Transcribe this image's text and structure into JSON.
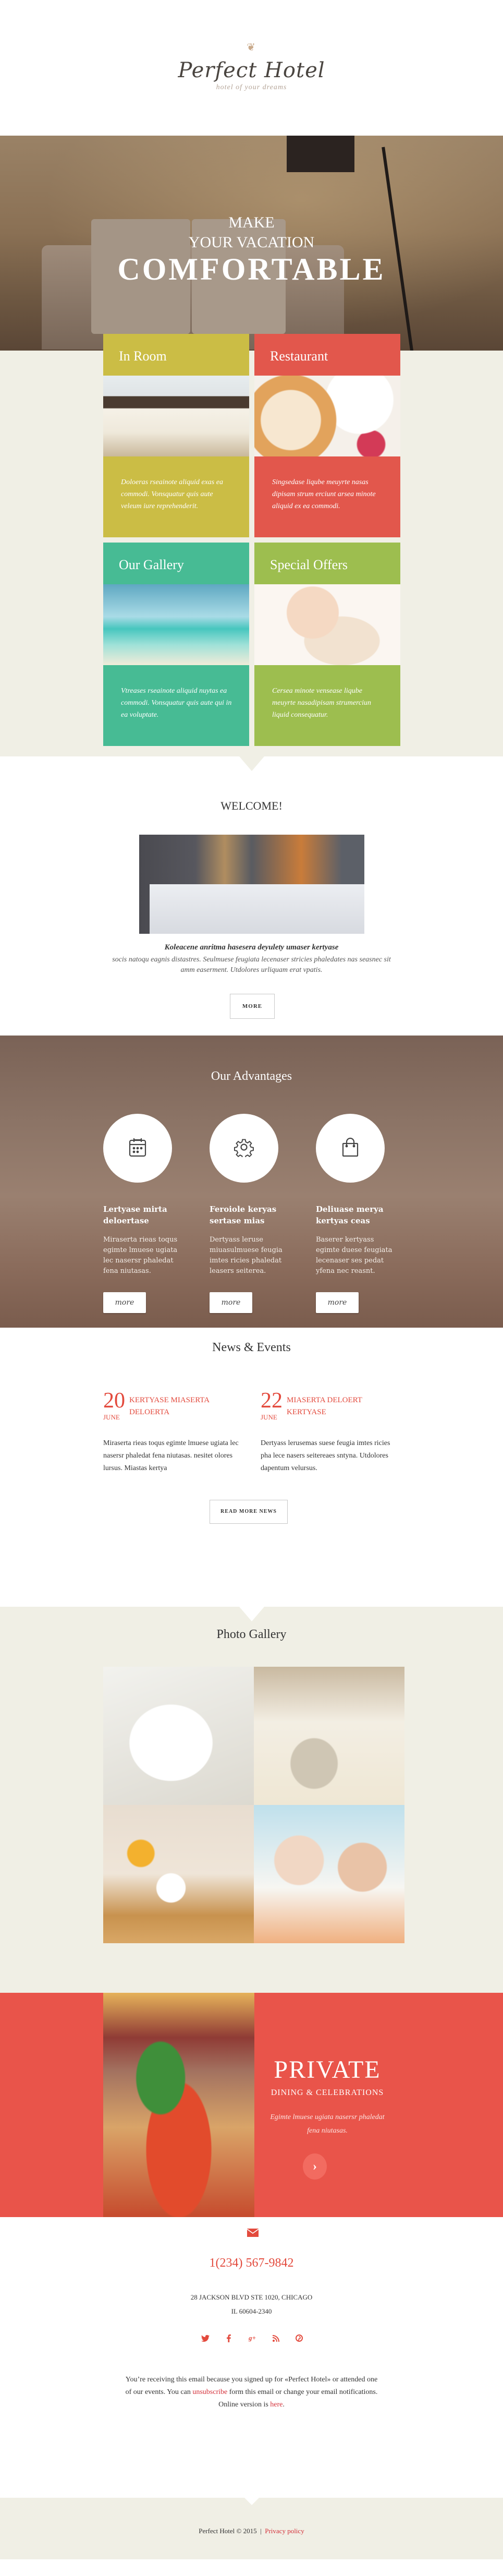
{
  "header": {
    "logo_text": "Perfect Hotel",
    "tagline": "hotel of your dreams",
    "ornament": "❦"
  },
  "hero": {
    "line1": "MAKE",
    "line2": "YOUR VACATION",
    "line3": "COMFORTABLE"
  },
  "features": [
    {
      "title": "In Room",
      "text": "Doloeras rseainote aliquid exas ea commodi. Vonsquatur quis aute veleum iure reprehenderit.",
      "color": "#cbbd45"
    },
    {
      "title": "Restaurant",
      "text": "Singsedase liqube meuyrte nasas dipisam strum erciunt arsea minote aliquid ex ea commodi.",
      "color": "#e2574c"
    },
    {
      "title": "Our Gallery",
      "text": "Vtreases rseainote aliquid nuytas ea commodi. Vonsquatur quis aute qui in ea voluptate.",
      "color": "#47bb94"
    },
    {
      "title": "Special Offers",
      "text": "Cersea minote vensease liqube meuyrte nasadipisam strumerciun liquid consequatur.",
      "color": "#9dbe4f"
    }
  ],
  "welcome": {
    "title": "WELCOME!",
    "bold_line": "Koleacene anritma hasesera deyulety umaser kertyase",
    "text": "socis natoqu eagnis distastres. Seulmuese feugiata lecenaser stricies phaledates nas seasnec sit amm easerment. Utdolores urliquam erat vpatis.",
    "button": "MORE"
  },
  "advantages": {
    "title": "Our Advantages",
    "items": [
      {
        "icon": "calendar-icon",
        "heading": "Lertyase mirta deloertase",
        "text": "Miraserta rieas toqus egimte lmuese ugiata lec nasersr phaledat fena niutasas.",
        "button": "more"
      },
      {
        "icon": "gear-icon",
        "heading": "Feroiole keryas sertase mias",
        "text": "Dertyass leruse miuasulmuese feugia imtes ricies phaledat leasers seiterea.",
        "button": "more"
      },
      {
        "icon": "shopping-bag-icon",
        "heading": "Deliuase merya kertyas ceas",
        "text": "Baserer kertyass egimte duese feugiata lecenaser ses pedat yfena nec reasnt.",
        "button": "more"
      }
    ]
  },
  "news": {
    "title": "News & Events",
    "items": [
      {
        "day": "20",
        "month": "JUNE",
        "headline": "KERTYASE MIASERTA DELOERTA",
        "body": "Miraserta rieas toqus egimte lmuese ugiata lec nasersr phaledat fena niutasas. nesitet olores lursus. Miastas kertya"
      },
      {
        "day": "22",
        "month": "JUNE",
        "headline": "MIASERTA DELOERT KERTYASE",
        "body": "Dertyass lerusemas suese feugia imtes ricies pha lece nasers seitereaes sntyna. Utdolores dapentum velursus."
      }
    ],
    "button": "READ MORE NEWS"
  },
  "gallery": {
    "title": "Photo Gallery",
    "photos": [
      "towels-photo",
      "bedding-photo",
      "breakfast-photo",
      "couple-photo"
    ]
  },
  "private": {
    "title": "PRIVATE",
    "subtitle": "DINING & CELEBRATIONS",
    "text": "Egimte lmuese ugiata nasersr phaledat fena niutasas.",
    "button_glyph": "›"
  },
  "contact": {
    "phone": "1(234) 567-9842",
    "address_line1": "28 JACKSON BLVD STE 1020, CHICAGO",
    "address_line2": "IL 60604-2340",
    "socials": [
      {
        "name": "twitter",
        "glyph": "t"
      },
      {
        "name": "facebook",
        "glyph": "f"
      },
      {
        "name": "google-plus",
        "glyph": "g+"
      },
      {
        "name": "rss",
        "glyph": "◉"
      },
      {
        "name": "pinterest",
        "glyph": "℗"
      }
    ],
    "notice_part1": "You’re receiving this email because you signed up for «Perfect Hotel» or attended one of our events. You can ",
    "unsubscribe_link": "unsubscribe",
    "notice_part2": " form this email or change your email notifications.",
    "online_prefix": "Online version is ",
    "here_link": "here",
    "online_suffix": "."
  },
  "footer": {
    "copyright": "Perfect Hotel © 2015",
    "separator": "|",
    "privacy_link": "Privacy policy"
  },
  "colors": {
    "accent_red": "#e34a3d",
    "cream": "#f0efe5"
  }
}
